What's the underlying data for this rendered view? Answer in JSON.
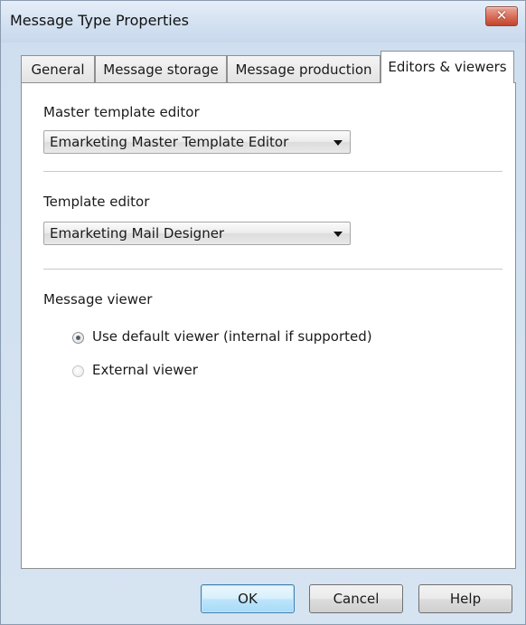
{
  "window": {
    "title": "Message Type Properties",
    "close_glyph": "✕"
  },
  "tabs": [
    {
      "label": "General",
      "active": false
    },
    {
      "label": "Message storage",
      "active": false
    },
    {
      "label": "Message production",
      "active": false
    },
    {
      "label": "Editors & viewers",
      "active": true
    }
  ],
  "master_template": {
    "label": "Master template editor",
    "selected": "Emarketing Master Template Editor"
  },
  "template": {
    "label": "Template editor",
    "selected": "Emarketing Mail Designer"
  },
  "viewer": {
    "label": "Message viewer",
    "options": [
      {
        "label": "Use default viewer (internal if supported)",
        "checked": true,
        "enabled": true
      },
      {
        "label": "External viewer",
        "checked": false,
        "enabled": false
      }
    ]
  },
  "buttons": {
    "ok": "OK",
    "cancel": "Cancel",
    "help": "Help"
  },
  "colors": {
    "titlebar": "#d3e1f1",
    "close_button": "#c2442c",
    "default_button_border": "#3c7fb1"
  }
}
